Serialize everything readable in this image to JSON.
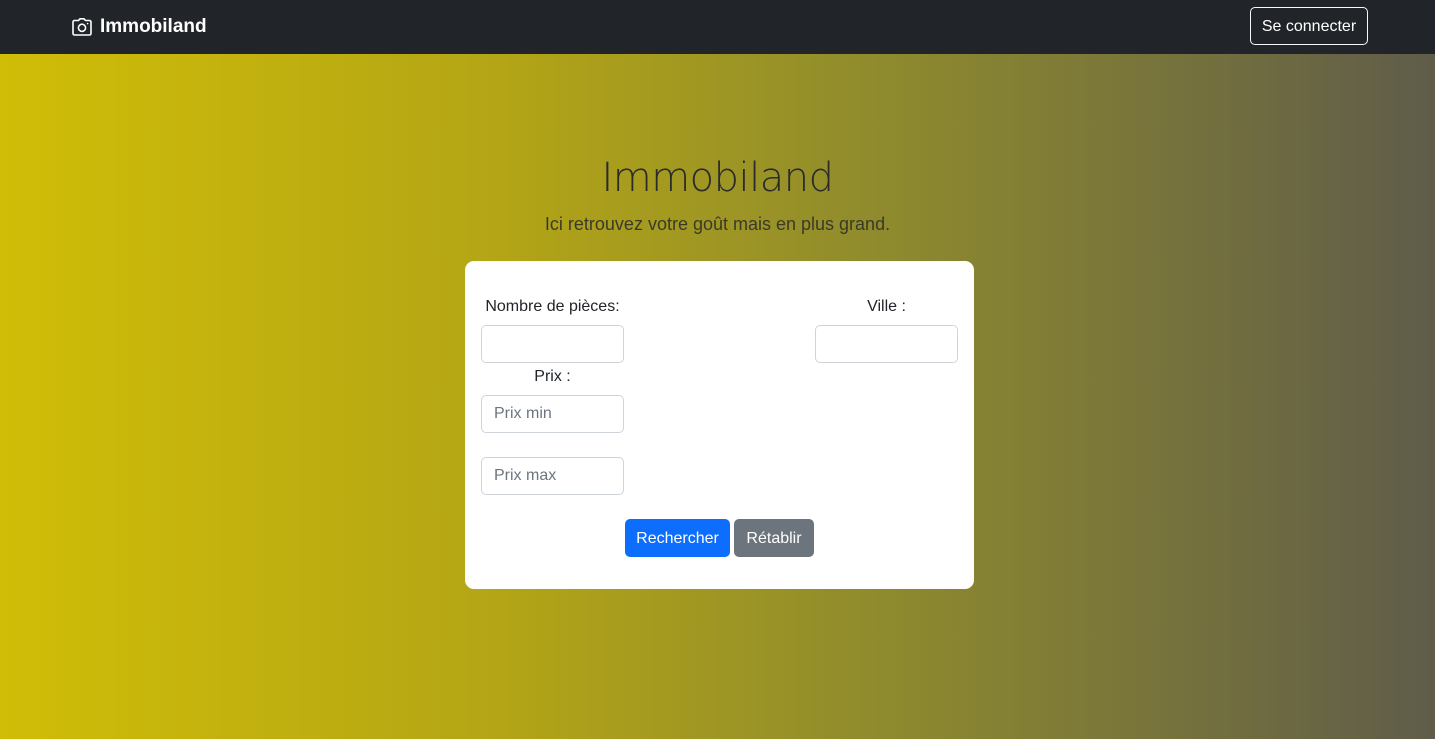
{
  "navbar": {
    "brand_label": "Immobiland",
    "brand_icon": "camera-icon",
    "login_label": "Se connecter"
  },
  "hero": {
    "title": "Immobiland",
    "subtitle": "Ici retrouvez votre goût mais en plus grand."
  },
  "search_form": {
    "rooms_label": "Nombre de pièces:",
    "rooms_value": "",
    "city_label": "Ville :",
    "city_value": "",
    "price_label": "Prix :",
    "price_min_placeholder": "Prix min",
    "price_max_placeholder": "Prix max",
    "search_label": "Rechercher",
    "reset_label": "Rétablir"
  },
  "colors": {
    "navbar_bg": "#212529",
    "gradient_start": "#d0bd07",
    "gradient_end": "#5f5c4a",
    "primary": "#0d6efd",
    "secondary": "#6c757d"
  }
}
